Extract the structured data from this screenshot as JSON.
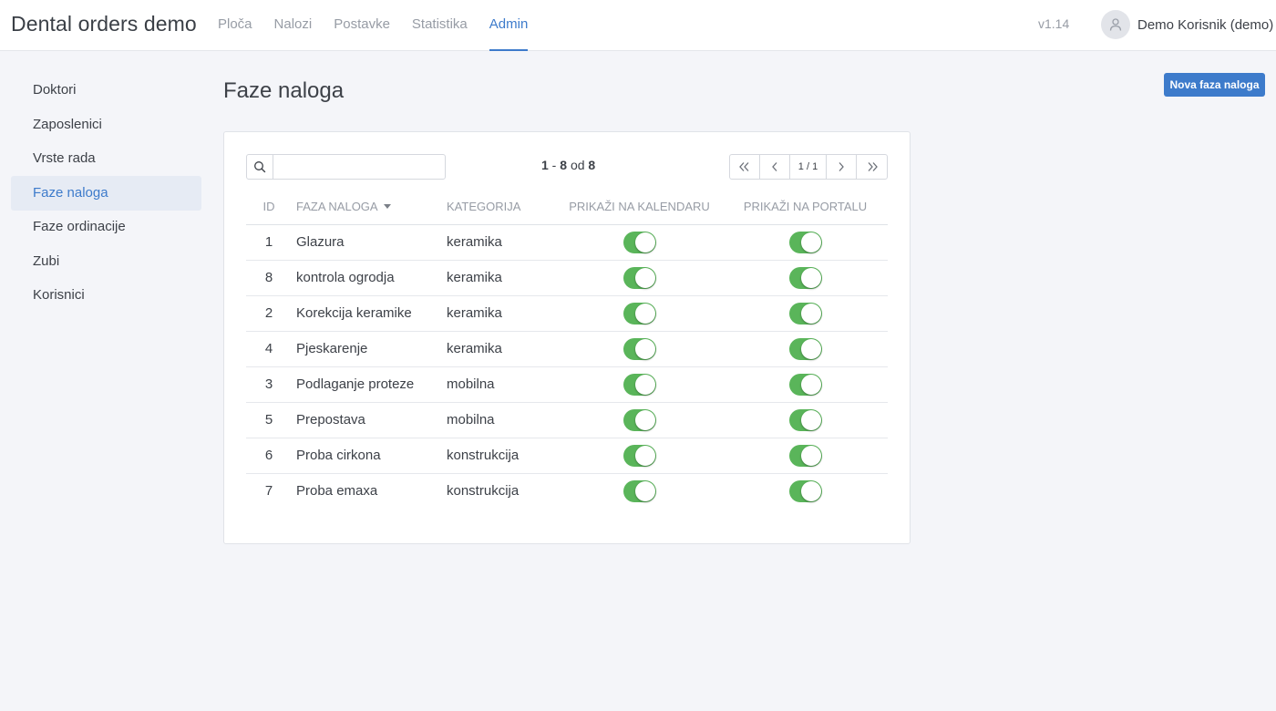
{
  "app": {
    "title": "Dental orders demo",
    "version": "v1.14"
  },
  "nav": [
    {
      "label": "Ploča",
      "active": false
    },
    {
      "label": "Nalozi",
      "active": false
    },
    {
      "label": "Postavke",
      "active": false
    },
    {
      "label": "Statistika",
      "active": false
    },
    {
      "label": "Admin",
      "active": true
    }
  ],
  "user": {
    "name": "Demo Korisnik (demo)",
    "icon": "user-icon"
  },
  "sidebar": [
    {
      "label": "Doktori",
      "active": false
    },
    {
      "label": "Zaposlenici",
      "active": false
    },
    {
      "label": "Vrste rada",
      "active": false
    },
    {
      "label": "Faze naloga",
      "active": true
    },
    {
      "label": "Faze ordinacije",
      "active": false
    },
    {
      "label": "Zubi",
      "active": false
    },
    {
      "label": "Korisnici",
      "active": false
    }
  ],
  "page": {
    "title": "Faze naloga",
    "new_button": "Nova faza naloga"
  },
  "search": {
    "placeholder": "",
    "value": "",
    "icon": "search-icon"
  },
  "pagination": {
    "from": "1",
    "to": "8",
    "of_label": "od",
    "total": "8",
    "page": "1 / 1"
  },
  "table": {
    "columns": {
      "id": "ID",
      "name": "FAZA NALOGA",
      "category": "KATEGORIJA",
      "calendar": "PRIKAŽI NA KALENDARU",
      "portal": "PRIKAŽI NA PORTALU"
    },
    "sort_column": "name",
    "rows": [
      {
        "id": "1",
        "name": "Glazura",
        "category": "keramika",
        "calendar": true,
        "portal": true
      },
      {
        "id": "8",
        "name": "kontrola ogrodja",
        "category": "keramika",
        "calendar": true,
        "portal": true
      },
      {
        "id": "2",
        "name": "Korekcija keramike",
        "category": "keramika",
        "calendar": true,
        "portal": true
      },
      {
        "id": "4",
        "name": "Pjeskarenje",
        "category": "keramika",
        "calendar": true,
        "portal": true
      },
      {
        "id": "3",
        "name": "Podlaganje proteze",
        "category": "mobilna",
        "calendar": true,
        "portal": true
      },
      {
        "id": "5",
        "name": "Prepostava",
        "category": "mobilna",
        "calendar": true,
        "portal": true
      },
      {
        "id": "6",
        "name": "Proba cirkona",
        "category": "konstrukcija",
        "calendar": true,
        "portal": true
      },
      {
        "id": "7",
        "name": "Proba emaxa",
        "category": "konstrukcija",
        "calendar": true,
        "portal": true
      }
    ]
  },
  "colors": {
    "accent": "#3d7bcb",
    "toggle_on": "#5ab55a",
    "background": "#f4f5f9"
  }
}
